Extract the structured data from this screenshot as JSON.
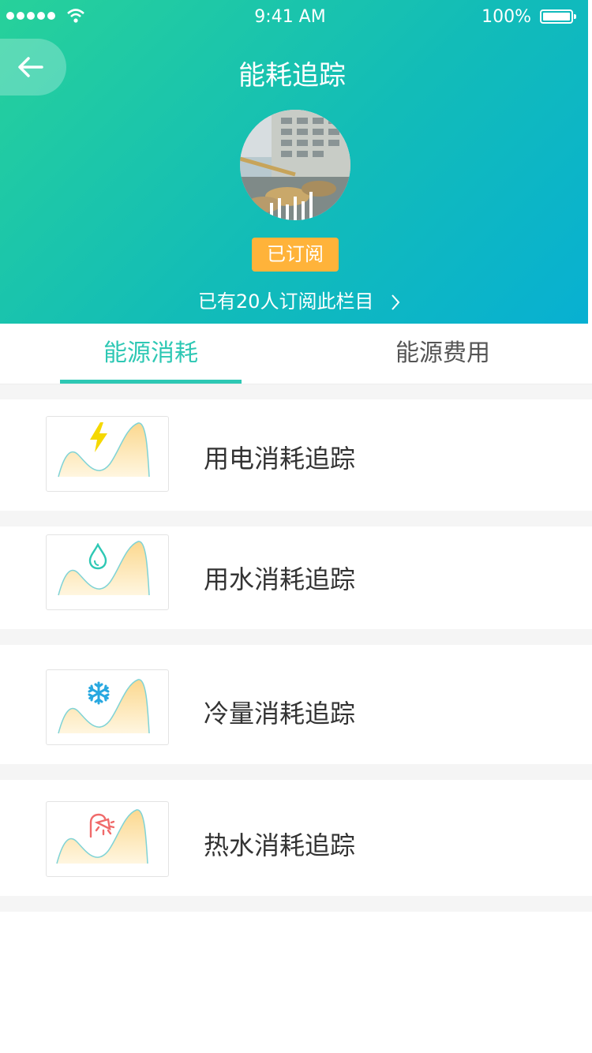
{
  "status_bar": {
    "time": "9:41 AM",
    "battery": "100%"
  },
  "header": {
    "title": "能耗追踪",
    "subscribed_badge": "已订阅",
    "subscriber_text": "已有20人订阅此栏目"
  },
  "tabs": [
    {
      "label": "能源消耗",
      "active": true
    },
    {
      "label": "能源费用",
      "active": false
    }
  ],
  "items": [
    {
      "label": "用电消耗追踪",
      "icon": "lightning-icon",
      "icon_color": "#f5d800"
    },
    {
      "label": "用水消耗追踪",
      "icon": "water-drop-icon",
      "icon_color": "#2ec8b4"
    },
    {
      "label": "冷量消耗追踪",
      "icon": "snowflake-icon",
      "icon_color": "#28a8e0"
    },
    {
      "label": "热水消耗追踪",
      "icon": "shower-icon",
      "icon_color": "#f06a6a"
    }
  ],
  "colors": {
    "accent": "#2ec8b4",
    "badge": "#ffb33a",
    "gradient_start": "#27d19a",
    "gradient_end": "#08b0d2"
  }
}
